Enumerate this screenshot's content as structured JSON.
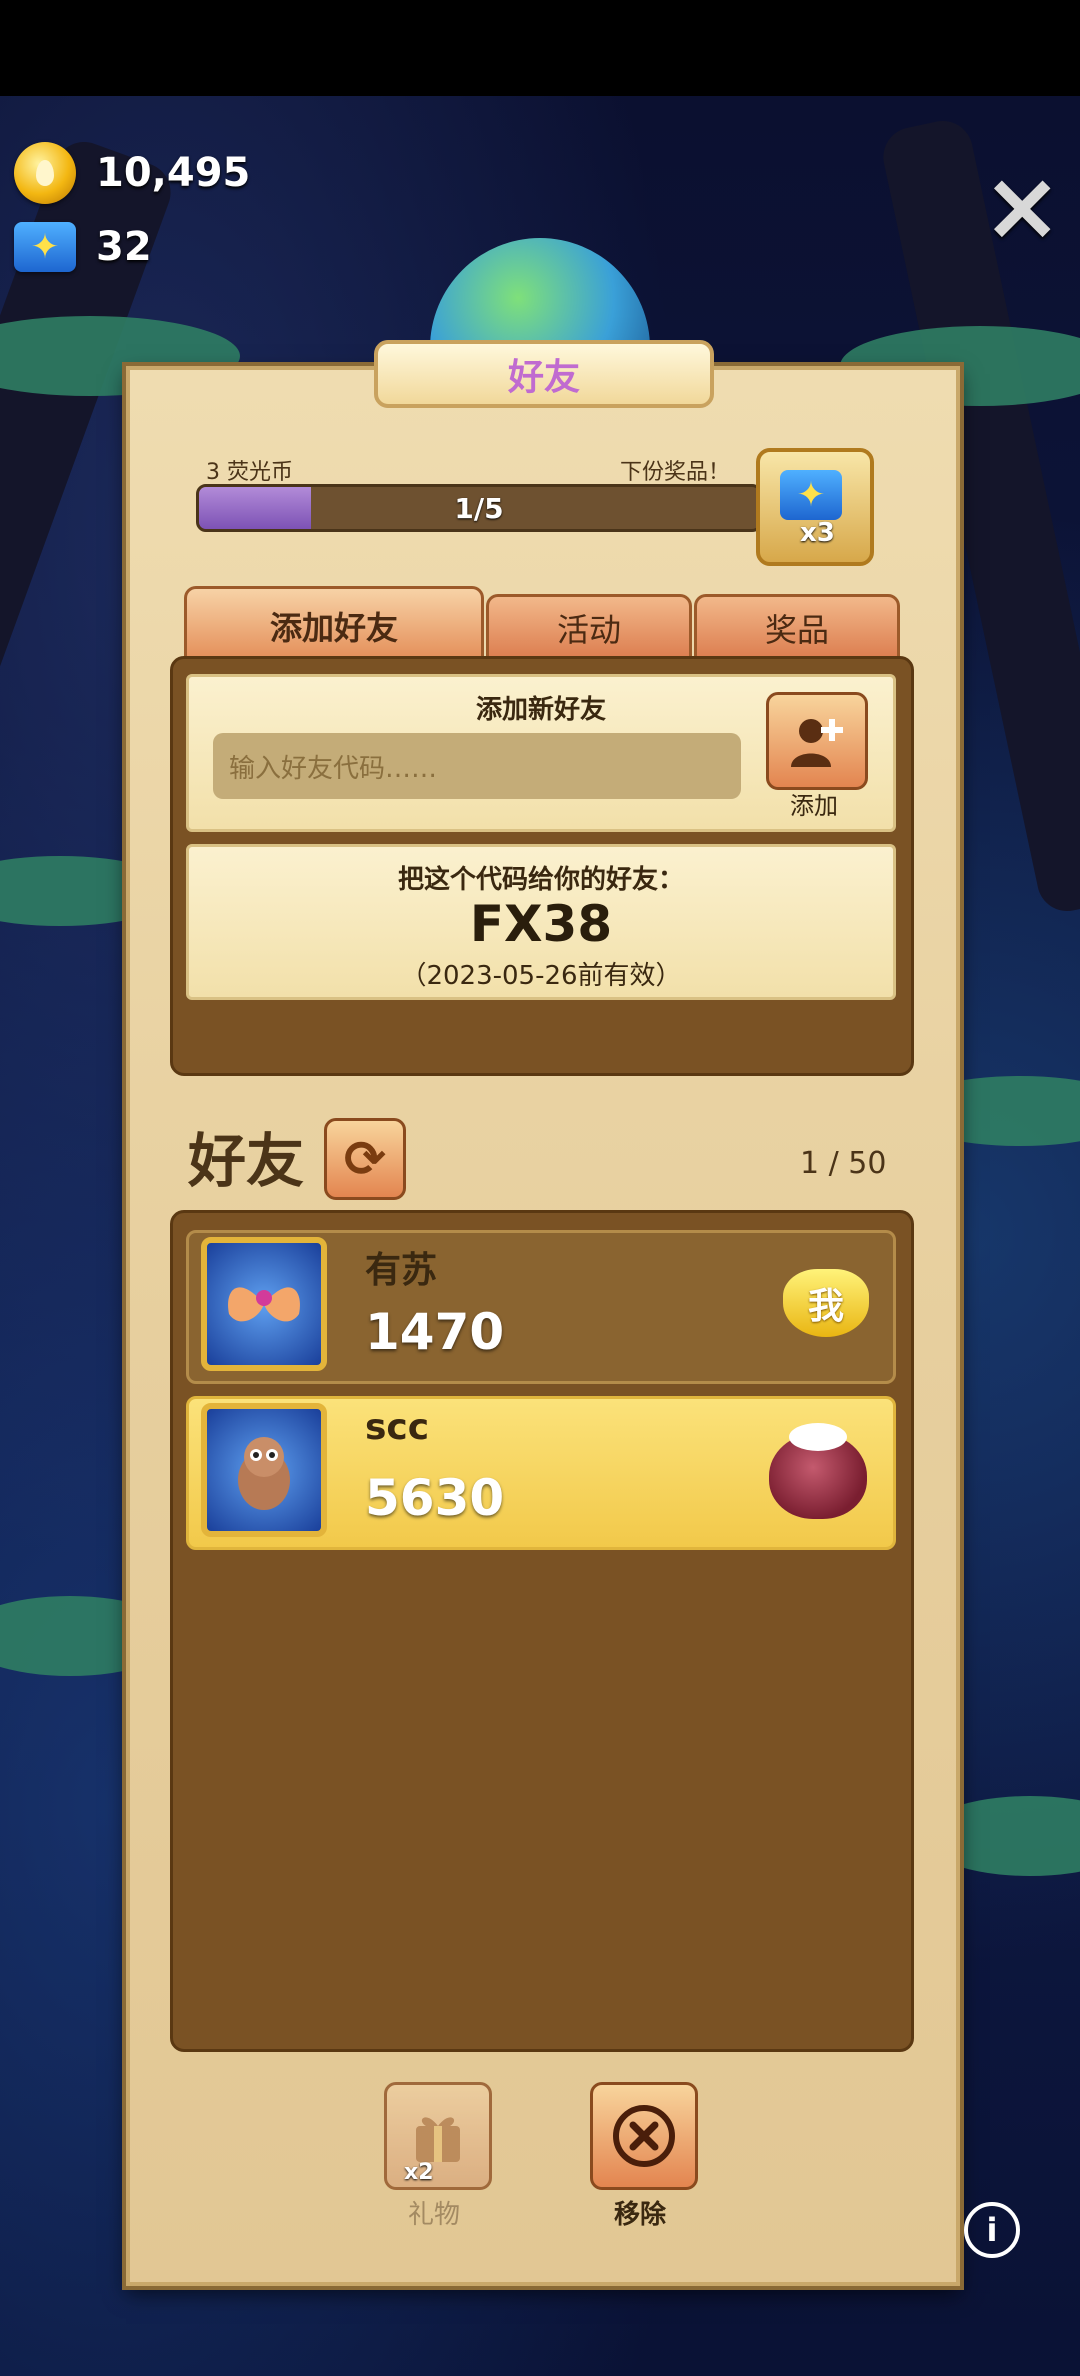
{
  "currency": {
    "coins": "10,495",
    "gems": "32"
  },
  "title": "好友",
  "progress": {
    "left_label": "3 荧光币",
    "right_label": "下份奖品！",
    "text": "1/5",
    "fraction": 0.2,
    "reward_qty": "x3"
  },
  "tabs": [
    {
      "label": "添加好友",
      "active": true
    },
    {
      "label": "活动",
      "active": false
    },
    {
      "label": "奖品",
      "active": false
    }
  ],
  "add_friend": {
    "title": "添加新好友",
    "placeholder": "输入好友代码……",
    "button_label": "添加"
  },
  "share_code": {
    "title": "把这个代码给你的好友：",
    "code": "FX38",
    "expiry": "（2023-05-26前有效）"
  },
  "friends_section": {
    "title": "好友",
    "count": "1 / 50"
  },
  "friends": [
    {
      "name": "有苏",
      "score": "1470",
      "badge": "我"
    },
    {
      "name": "scc",
      "score": "5630"
    }
  ],
  "actions": {
    "gift_label": "礼物",
    "gift_qty": "x2",
    "remove_label": "移除"
  },
  "colors": {
    "panel": "#e7cf9e",
    "tab": "#dc7d4f",
    "list_bg": "#7a5224",
    "highlight_row": "#f2c94a",
    "progress_fill": "#7d52b5"
  }
}
